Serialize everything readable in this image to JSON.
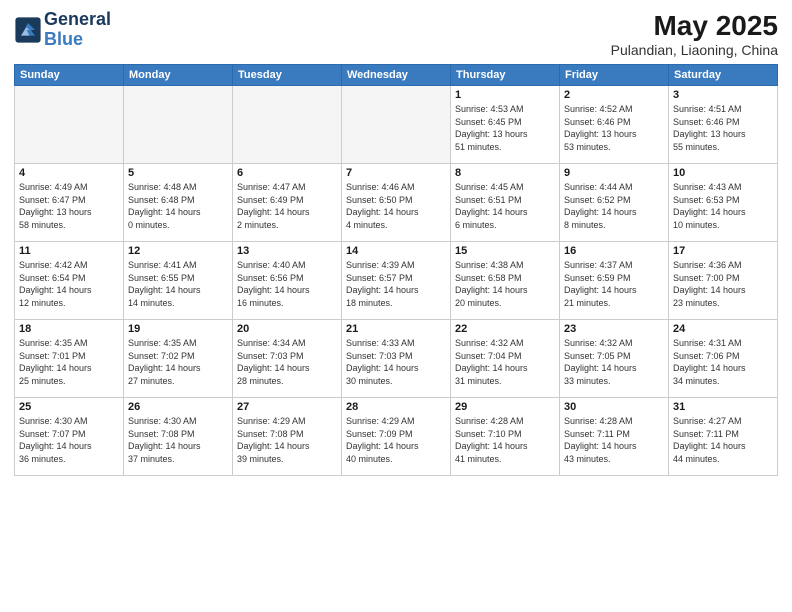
{
  "header": {
    "logo_line1": "General",
    "logo_line2": "Blue",
    "month_year": "May 2025",
    "location": "Pulandian, Liaoning, China"
  },
  "weekdays": [
    "Sunday",
    "Monday",
    "Tuesday",
    "Wednesday",
    "Thursday",
    "Friday",
    "Saturday"
  ],
  "weeks": [
    [
      {
        "day": "",
        "empty": true
      },
      {
        "day": "",
        "empty": true
      },
      {
        "day": "",
        "empty": true
      },
      {
        "day": "",
        "empty": true
      },
      {
        "day": "1",
        "sunrise": "4:53 AM",
        "sunset": "6:45 PM",
        "daylight": "13 hours and 51 minutes."
      },
      {
        "day": "2",
        "sunrise": "4:52 AM",
        "sunset": "6:46 PM",
        "daylight": "13 hours and 53 minutes."
      },
      {
        "day": "3",
        "sunrise": "4:51 AM",
        "sunset": "6:46 PM",
        "daylight": "13 hours and 55 minutes."
      }
    ],
    [
      {
        "day": "4",
        "sunrise": "4:49 AM",
        "sunset": "6:47 PM",
        "daylight": "13 hours and 58 minutes."
      },
      {
        "day": "5",
        "sunrise": "4:48 AM",
        "sunset": "6:48 PM",
        "daylight": "14 hours and 0 minutes."
      },
      {
        "day": "6",
        "sunrise": "4:47 AM",
        "sunset": "6:49 PM",
        "daylight": "14 hours and 2 minutes."
      },
      {
        "day": "7",
        "sunrise": "4:46 AM",
        "sunset": "6:50 PM",
        "daylight": "14 hours and 4 minutes."
      },
      {
        "day": "8",
        "sunrise": "4:45 AM",
        "sunset": "6:51 PM",
        "daylight": "14 hours and 6 minutes."
      },
      {
        "day": "9",
        "sunrise": "4:44 AM",
        "sunset": "6:52 PM",
        "daylight": "14 hours and 8 minutes."
      },
      {
        "day": "10",
        "sunrise": "4:43 AM",
        "sunset": "6:53 PM",
        "daylight": "14 hours and 10 minutes."
      }
    ],
    [
      {
        "day": "11",
        "sunrise": "4:42 AM",
        "sunset": "6:54 PM",
        "daylight": "14 hours and 12 minutes."
      },
      {
        "day": "12",
        "sunrise": "4:41 AM",
        "sunset": "6:55 PM",
        "daylight": "14 hours and 14 minutes."
      },
      {
        "day": "13",
        "sunrise": "4:40 AM",
        "sunset": "6:56 PM",
        "daylight": "14 hours and 16 minutes."
      },
      {
        "day": "14",
        "sunrise": "4:39 AM",
        "sunset": "6:57 PM",
        "daylight": "14 hours and 18 minutes."
      },
      {
        "day": "15",
        "sunrise": "4:38 AM",
        "sunset": "6:58 PM",
        "daylight": "14 hours and 20 minutes."
      },
      {
        "day": "16",
        "sunrise": "4:37 AM",
        "sunset": "6:59 PM",
        "daylight": "14 hours and 21 minutes."
      },
      {
        "day": "17",
        "sunrise": "4:36 AM",
        "sunset": "7:00 PM",
        "daylight": "14 hours and 23 minutes."
      }
    ],
    [
      {
        "day": "18",
        "sunrise": "4:35 AM",
        "sunset": "7:01 PM",
        "daylight": "14 hours and 25 minutes."
      },
      {
        "day": "19",
        "sunrise": "4:35 AM",
        "sunset": "7:02 PM",
        "daylight": "14 hours and 27 minutes."
      },
      {
        "day": "20",
        "sunrise": "4:34 AM",
        "sunset": "7:03 PM",
        "daylight": "14 hours and 28 minutes."
      },
      {
        "day": "21",
        "sunrise": "4:33 AM",
        "sunset": "7:03 PM",
        "daylight": "14 hours and 30 minutes."
      },
      {
        "day": "22",
        "sunrise": "4:32 AM",
        "sunset": "7:04 PM",
        "daylight": "14 hours and 31 minutes."
      },
      {
        "day": "23",
        "sunrise": "4:32 AM",
        "sunset": "7:05 PM",
        "daylight": "14 hours and 33 minutes."
      },
      {
        "day": "24",
        "sunrise": "4:31 AM",
        "sunset": "7:06 PM",
        "daylight": "14 hours and 34 minutes."
      }
    ],
    [
      {
        "day": "25",
        "sunrise": "4:30 AM",
        "sunset": "7:07 PM",
        "daylight": "14 hours and 36 minutes."
      },
      {
        "day": "26",
        "sunrise": "4:30 AM",
        "sunset": "7:08 PM",
        "daylight": "14 hours and 37 minutes."
      },
      {
        "day": "27",
        "sunrise": "4:29 AM",
        "sunset": "7:08 PM",
        "daylight": "14 hours and 39 minutes."
      },
      {
        "day": "28",
        "sunrise": "4:29 AM",
        "sunset": "7:09 PM",
        "daylight": "14 hours and 40 minutes."
      },
      {
        "day": "29",
        "sunrise": "4:28 AM",
        "sunset": "7:10 PM",
        "daylight": "14 hours and 41 minutes."
      },
      {
        "day": "30",
        "sunrise": "4:28 AM",
        "sunset": "7:11 PM",
        "daylight": "14 hours and 43 minutes."
      },
      {
        "day": "31",
        "sunrise": "4:27 AM",
        "sunset": "7:11 PM",
        "daylight": "14 hours and 44 minutes."
      }
    ]
  ]
}
